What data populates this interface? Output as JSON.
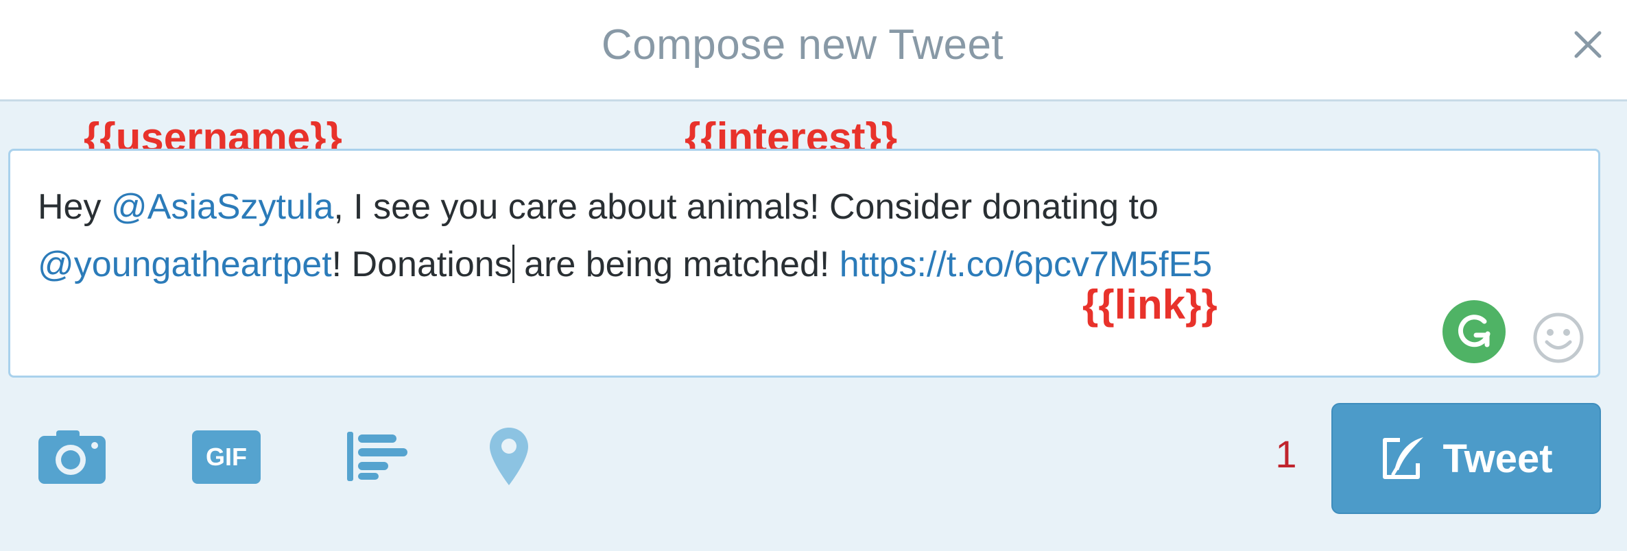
{
  "header": {
    "title": "Compose new Tweet",
    "close_icon": "close-icon"
  },
  "annotations": {
    "username": "{{username}}",
    "interest": "{{interest}}",
    "link": "{{link}}"
  },
  "editor": {
    "segments": {
      "s1": "Hey ",
      "mention1": "@AsiaSzytula",
      "s2": ", I see you care about animals! Consider donating to",
      "mention2": "@youngatheartpet",
      "s3a": "! Donations",
      "s3b": " are being matched! ",
      "link": "https://t.co/6pcv7M5fE5"
    },
    "grammarly_icon": "grammarly-icon",
    "emoji_icon": "emoji-smiley-icon"
  },
  "toolbar": {
    "icons": [
      "camera-icon",
      "gif-icon",
      "poll-icon",
      "location-icon"
    ],
    "gif_label": "GIF"
  },
  "footer": {
    "char_count": "1",
    "tweet_label": "Tweet"
  },
  "colors": {
    "accent": "#4c9bc9",
    "mention": "#2b7bb9",
    "annotation": "#e8322b",
    "counter": "#c0242d",
    "grammarly": "#4fb365"
  }
}
